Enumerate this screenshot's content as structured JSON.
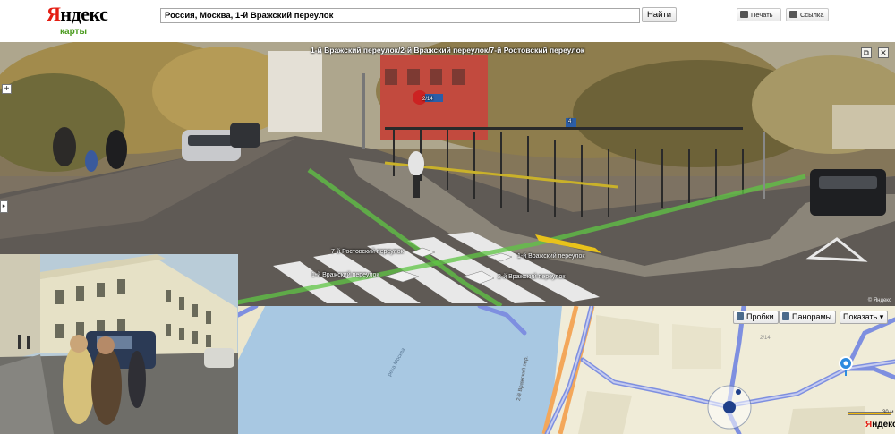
{
  "header": {
    "logo_first": "Я",
    "logo_rest": "ндекс",
    "logo_sub": "карты",
    "search_value": "Россия, Москва, 1-й Вражский переулок",
    "search_button": "Найти",
    "print_button": "Печать",
    "link_button": "Ссылка"
  },
  "panorama": {
    "title": "1-й Вражский переулок/2-й Вражский переулок/7-й Ростовский переулок",
    "street_labels": [
      "7-й Ростовский переулок",
      "1-й Вражский переулок",
      "1-й Вражский переулок",
      "2-й Вражский переулок"
    ],
    "sign_number": "2/14",
    "house_number": "4",
    "copyright": "© Яндекс"
  },
  "map": {
    "traffic_button": "Пробки",
    "panoramas_button": "Панорамы",
    "show_button": "Показать",
    "river_label": "река Москва",
    "street_label": "2-й Вражский пер.",
    "house_number": "2/14",
    "scale_label": "30 м",
    "brand_first": "Я",
    "brand_rest": "ндекс"
  }
}
